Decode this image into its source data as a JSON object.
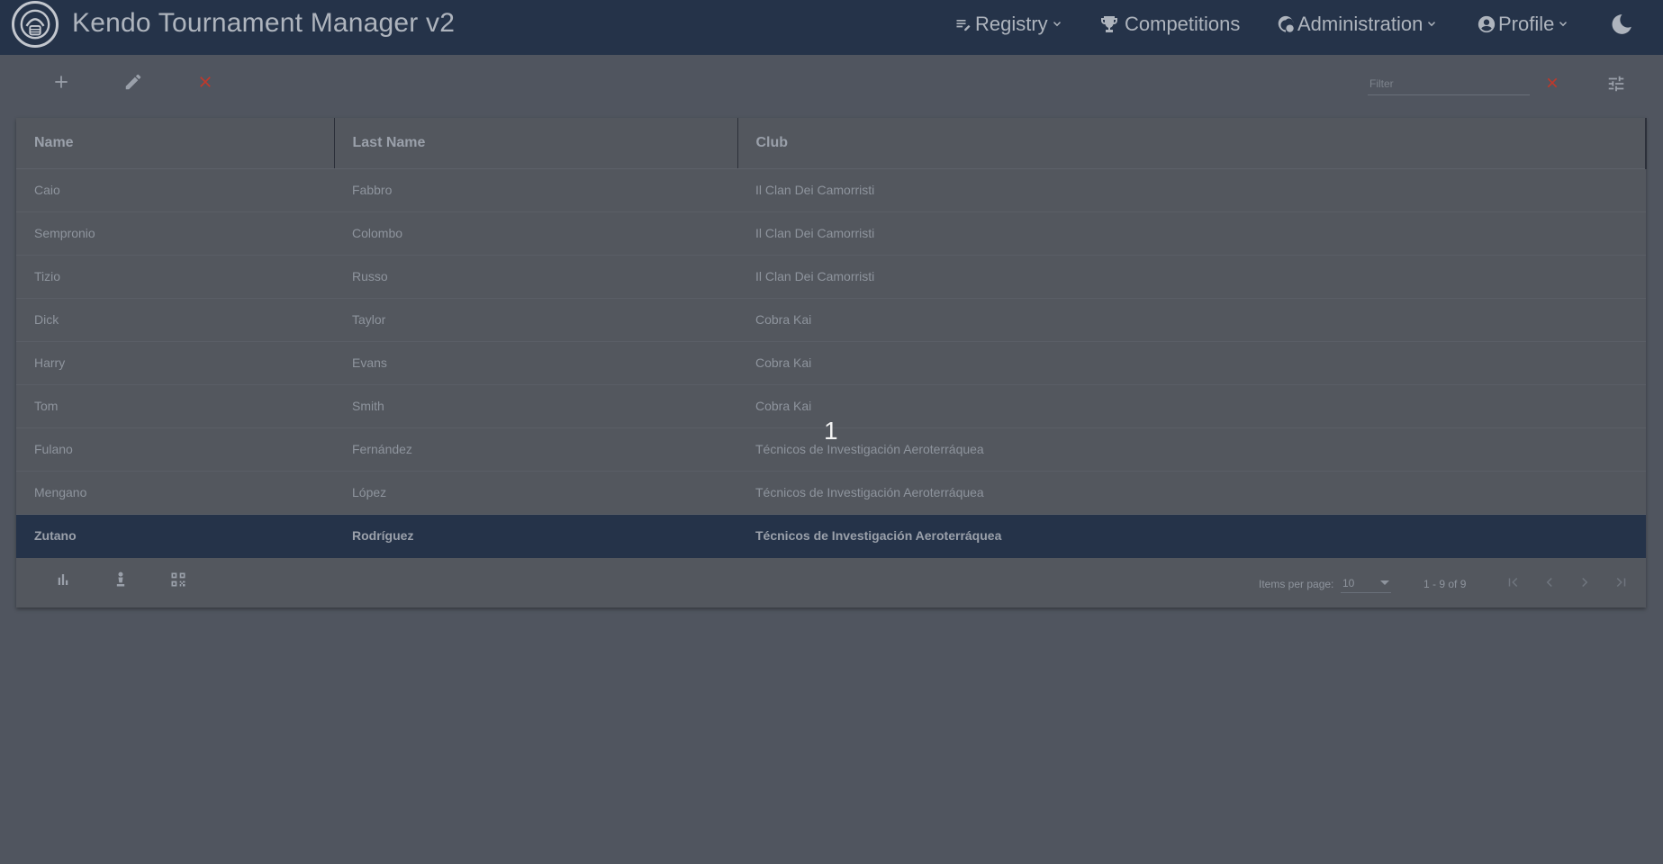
{
  "app": {
    "title": "Kendo Tournament Manager v2"
  },
  "nav": {
    "registry": "Registry",
    "competitions": "Competitions",
    "administration": "Administration",
    "profile": "Profile"
  },
  "icons": {
    "add": "plus-icon",
    "edit": "pencil-icon",
    "delete": "close-icon",
    "clear_filter": "close-icon",
    "columns": "tune-icon",
    "stats": "bar-chart-icon",
    "fighter": "chess-pawn-icon",
    "qr": "qr-code-icon",
    "theme": "moon-icon"
  },
  "toolbar": {
    "filter_placeholder": "Filter"
  },
  "table": {
    "headers": [
      "Name",
      "Last Name",
      "Club"
    ],
    "rows": [
      {
        "name": "Caio",
        "last": "Fabbro",
        "club": "Il Clan Dei Camorristi"
      },
      {
        "name": "Sempronio",
        "last": "Colombo",
        "club": "Il Clan Dei Camorristi"
      },
      {
        "name": "Tizio",
        "last": "Russo",
        "club": "Il Clan Dei Camorristi"
      },
      {
        "name": "Dick",
        "last": "Taylor",
        "club": "Cobra Kai"
      },
      {
        "name": "Harry",
        "last": "Evans",
        "club": "Cobra Kai"
      },
      {
        "name": "Tom",
        "last": "Smith",
        "club": "Cobra Kai"
      },
      {
        "name": "Fulano",
        "last": "Fernández",
        "club": "Técnicos de Investigación Aeroterráquea"
      },
      {
        "name": "Mengano",
        "last": "López",
        "club": "Técnicos de Investigación Aeroterráquea"
      },
      {
        "name": "Zutano",
        "last": "Rodríguez",
        "club": "Técnicos de Investigación Aeroterráquea"
      }
    ]
  },
  "paginator": {
    "items_per_page_label": "Items per page:",
    "items_per_page": "10",
    "range": "1 - 9 of 9"
  },
  "overlay": {
    "marker": "1"
  },
  "colors": {
    "nav_background": "#253349",
    "page_background": "#50555f",
    "selected_row": "#253349",
    "danger": "#c0392b"
  }
}
